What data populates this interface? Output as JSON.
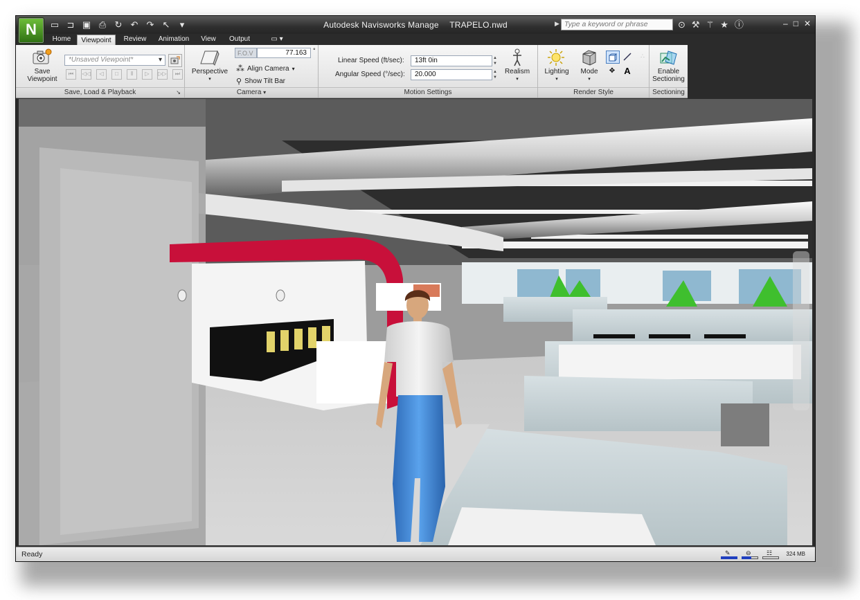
{
  "window": {
    "app_name": "Autodesk Navisworks Manage",
    "file_name": "TRAPELO.nwd",
    "search_placeholder": "Type a keyword or phrase",
    "app_icon": "N",
    "quick_access_icons": [
      "new-icon",
      "open-icon",
      "save-icon",
      "print-icon",
      "refresh-icon",
      "undo-icon",
      "redo-icon",
      "select-icon",
      "customize-icon"
    ],
    "search_tool_icons": [
      "binoculars-icon",
      "wrench-icon",
      "satellite-icon",
      "star-icon",
      "help-icon"
    ],
    "controls": [
      "–",
      "□",
      "✕"
    ]
  },
  "tabs": [
    "Home",
    "Viewpoint",
    "Review",
    "Animation",
    "View",
    "Output"
  ],
  "active_tab": "Viewpoint",
  "ribbon": {
    "save_load": {
      "save_label_1": "Save",
      "save_label_2": "Viewpoint",
      "viewpoint_select": "*Unsaved Viewpoint*",
      "panel_label": "Save, Load & Playback"
    },
    "camera": {
      "perspective_label": "Perspective",
      "fov_label": "F.O.V",
      "fov_value": "77.163",
      "fov_unit": "°",
      "align_camera": "Align Camera",
      "show_tilt_bar": "Show Tilt Bar",
      "panel_label": "Camera"
    },
    "motion": {
      "linear_label": "Linear Speed (ft/sec):",
      "linear_value": "13ft 0in",
      "angular_label": "Angular Speed (°/sec):",
      "angular_value": "20.000",
      "realism_label": "Realism",
      "panel_label": "Motion Settings"
    },
    "render": {
      "lighting_label": "Lighting",
      "mode_label": "Mode",
      "text_tool": "A",
      "panel_label": "Render Style"
    },
    "sectioning": {
      "enable_label_1": "Enable",
      "enable_label_2": "Sectioning",
      "panel_label": "Sectioning"
    }
  },
  "status": {
    "text": "Ready",
    "memory": "324 MB"
  },
  "colors": {
    "title_bar": "#2f2f2f",
    "ribbon": "#e6e6e6",
    "pod_red": "#c8103a",
    "cubicle": "#c9d3d6",
    "jeans": "#3a7fd0"
  }
}
